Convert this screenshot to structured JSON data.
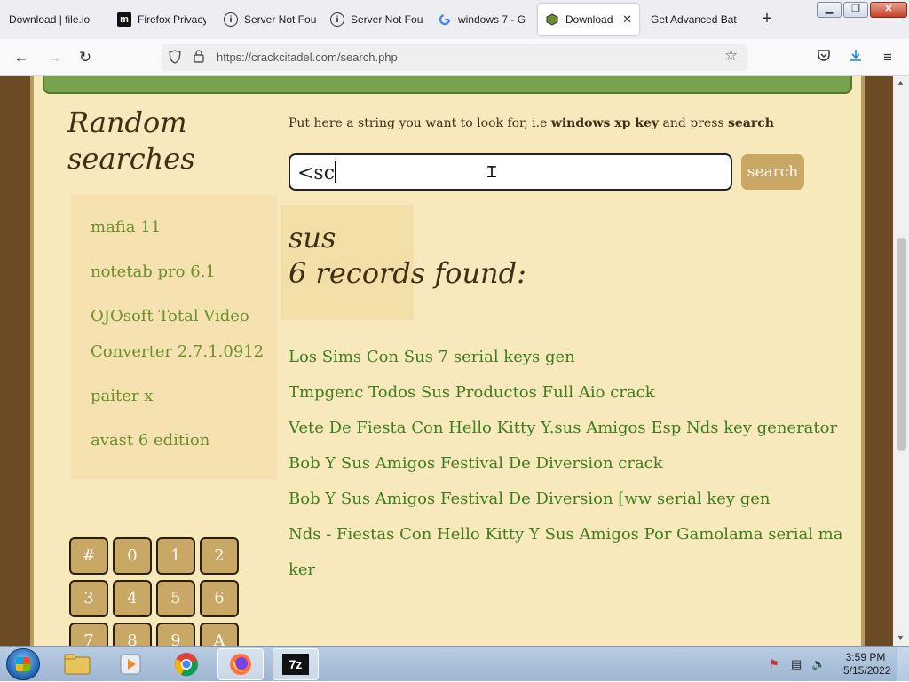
{
  "browser": {
    "tabs": [
      {
        "title": "Download | file.io",
        "icon": "none"
      },
      {
        "title": "Firefox Privacy",
        "icon": "m-logo-icon"
      },
      {
        "title": "Server Not Fou",
        "icon": "info-icon"
      },
      {
        "title": "Server Not Fou",
        "icon": "info-icon"
      },
      {
        "title": "windows 7 - G",
        "icon": "google-icon"
      },
      {
        "title": "Download s",
        "icon": "page-icon",
        "active": true
      },
      {
        "title": "Get Advanced Bat",
        "icon": "none"
      }
    ],
    "url": "https://crackcitadel.com/search.php"
  },
  "page": {
    "random_title_line1": "Random",
    "random_title_line2": "searches",
    "random_items": [
      "mafia 11",
      "notetab pro 6.1",
      "OJOsoft Total Video",
      "Converter 2.7.1.0912",
      "paiter x",
      "avast 6 edition"
    ],
    "hint_pre": "Put here a string you want to look for, i.e ",
    "hint_example": "windows xp key",
    "hint_mid": " and press ",
    "hint_action": "search",
    "search_value": "<sc",
    "search_button": "search",
    "query": "sus",
    "records_found": "6 records found:",
    "results": [
      "Los Sims Con Sus 7 serial keys gen",
      "Tmpgenc Todos Sus Productos Full Aio crack",
      "Vete De Fiesta Con Hello Kitty Y.sus Amigos Esp Nds key generator",
      "Bob Y Sus Amigos Festival De Diversion crack",
      "Bob Y Sus Amigos Festival De Diversion [ww serial key gen",
      "Nds - Fiestas Con Hello Kitty Y Sus Amigos Por Gamolama serial ma",
      "ker"
    ],
    "alpha_buttons": [
      "#",
      "0",
      "1",
      "2",
      "3",
      "4",
      "5",
      "6",
      "7",
      "8",
      "9",
      "A"
    ]
  },
  "taskbar": {
    "time": "3:59 PM",
    "date": "5/15/2022"
  },
  "colors": {
    "parchment": "#f8e9bd",
    "link_green": "#3f7d1e",
    "light_green": "#6b8f2e",
    "button_tan": "#c9a865",
    "header_green": "#78a24d"
  }
}
